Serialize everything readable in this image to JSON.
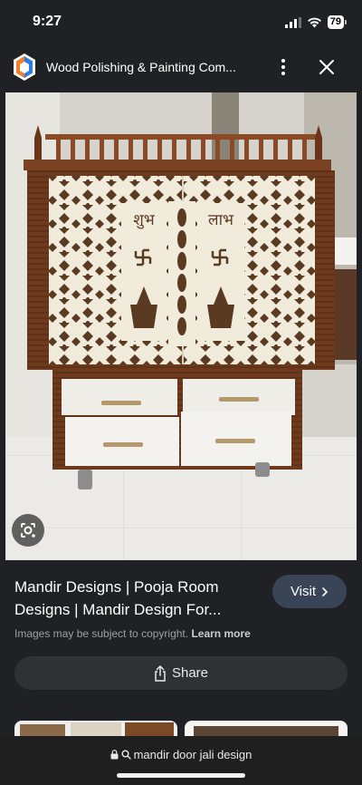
{
  "status_bar": {
    "time": "9:27",
    "battery": "79"
  },
  "header": {
    "title": "Wood Polishing & Painting Com...",
    "icons": [
      "site-logo",
      "more-vertical-icon",
      "close-icon"
    ]
  },
  "image": {
    "shubh_text": "शुभ",
    "labh_text": "लाभ"
  },
  "result": {
    "title": "Mandir Designs | Pooja Room Designs | Mandir Design For...",
    "visit_label": "Visit",
    "copyright_text": "Images may be subject to copyright.",
    "learn_more_label": "Learn more",
    "share_label": "Share"
  },
  "bottom_bar": {
    "url_text": "mandir door jali design"
  },
  "colors": {
    "background": "#202124",
    "visit_button": "#394457",
    "share_button": "#303134"
  }
}
